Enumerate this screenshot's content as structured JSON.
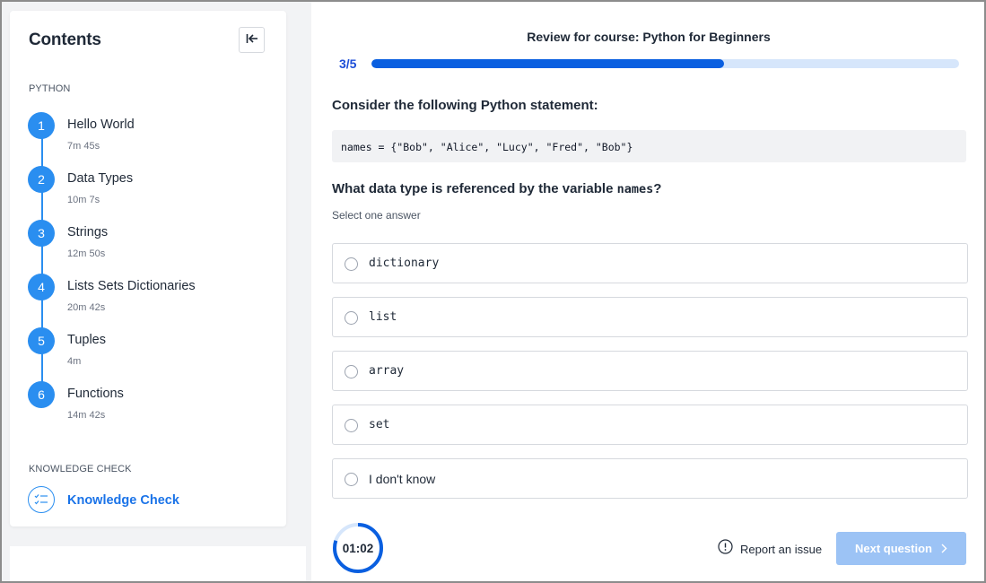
{
  "sidebar": {
    "title": "Contents",
    "section_python": "PYTHON",
    "lessons": [
      {
        "num": "1",
        "title": "Hello World",
        "duration": "7m 45s"
      },
      {
        "num": "2",
        "title": "Data Types",
        "duration": "10m 7s"
      },
      {
        "num": "3",
        "title": "Strings",
        "duration": "12m 50s"
      },
      {
        "num": "4",
        "title": "Lists Sets Dictionaries",
        "duration": "20m 42s"
      },
      {
        "num": "5",
        "title": "Tuples",
        "duration": "4m"
      },
      {
        "num": "6",
        "title": "Functions",
        "duration": "14m 42s"
      }
    ],
    "section_knowledge": "KNOWLEDGE CHECK",
    "knowledge_check_label": "Knowledge Check",
    "icons": {
      "collapse": "collapse-left-icon",
      "knowledge_check": "checklist-icon"
    }
  },
  "review": {
    "title": "Review for course: Python for Beginners",
    "progress_label": "3/5",
    "progress_fraction": 0.6
  },
  "question": {
    "intro": "Consider the following Python statement:",
    "code": "names = {\"Bob\", \"Alice\", \"Lucy\", \"Fred\", \"Bob\"}",
    "prompt_before": "What data type is referenced by the variable ",
    "prompt_code": "names",
    "prompt_after": "?",
    "hint": "Select one answer",
    "options": [
      "dictionary",
      "list",
      "array",
      "set",
      "I don't know"
    ]
  },
  "footer": {
    "timer": "01:02",
    "timer_fraction": 0.8,
    "report_label": "Report an issue",
    "next_label": "Next question"
  },
  "colors": {
    "accent": "#2a8ef0",
    "progress_fill": "#0a5fe0",
    "progress_track": "#d6e6fb",
    "next_button": "#9cc3f5"
  }
}
